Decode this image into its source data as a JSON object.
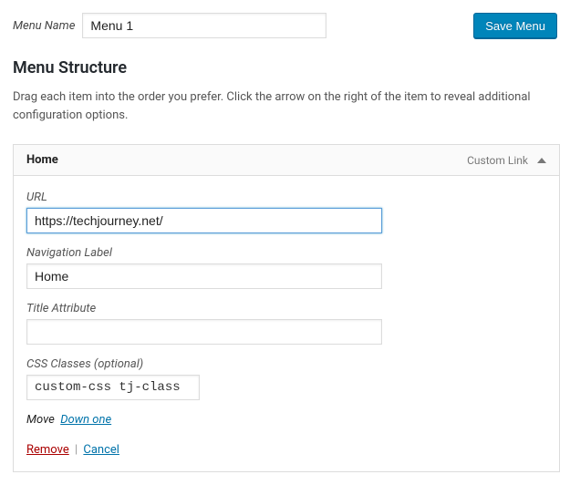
{
  "top": {
    "menu_name_label": "Menu Name",
    "menu_name_value": "Menu 1",
    "save_label": "Save Menu"
  },
  "section": {
    "title": "Menu Structure",
    "description": "Drag each item into the order you prefer. Click the arrow on the right of the item to reveal additional configuration options."
  },
  "item": {
    "title": "Home",
    "type_label": "Custom Link",
    "fields": {
      "url": {
        "label": "URL",
        "value": "https://techjourney.net/"
      },
      "nav_label": {
        "label": "Navigation Label",
        "value": "Home"
      },
      "title_attr": {
        "label": "Title Attribute",
        "value": ""
      },
      "css_classes": {
        "label": "CSS Classes (optional)",
        "value": "custom-css tj-class"
      }
    },
    "move_label": "Move",
    "move_down_label": "Down one",
    "remove_label": "Remove",
    "cancel_label": "Cancel"
  }
}
